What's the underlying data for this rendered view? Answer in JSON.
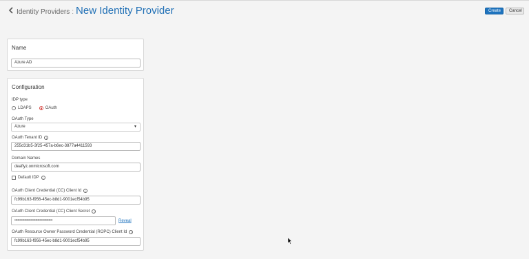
{
  "header": {
    "back_icon": "chevron-left-icon",
    "breadcrumb": "Identity Providers",
    "separator": ":",
    "title": "New Identity Provider"
  },
  "toolbar": {
    "create_label": "Create",
    "cancel_label": "Cancel"
  },
  "name_panel": {
    "title": "Name",
    "name_value": "Azure AD"
  },
  "config_panel": {
    "title": "Configuration",
    "idp_type_label": "IDP type",
    "idp_options": [
      {
        "label": "LDAPS",
        "checked": false
      },
      {
        "label": "OAuth",
        "checked": true
      }
    ],
    "oauth_type_label": "OAuth Type",
    "oauth_type_value": "Azure",
    "tenant_id_label": "OAuth Tenant ID",
    "tenant_id_value": "255d31b5-3f25-457a-b6ec-3877a4411593",
    "domain_names_label": "Domain Names",
    "domain_names_value": "deaflyz.onmicrosoft.com",
    "default_idp_label": "Default IDP",
    "cc_client_id_label": "OAuth Client Credential (CC) Client Id",
    "cc_client_id_value": "fc99b163-f956-45ec-b8d1-9001ecf54b95",
    "cc_client_secret_label": "OAuth Client Credential (CC) Client Secret",
    "cc_client_secret_value": "••••••••••••••••••••••••••••••••••••••",
    "reveal_label": "Reveal",
    "ropc_client_id_label": "OAuth Resource Owner Password Credential (ROPC) Client Id",
    "ropc_client_id_value": "fc99b163-f956-45ec-b8d1-9001ecf54b95"
  },
  "colors": {
    "accent": "#1f6fb5",
    "radio_checked": "#d9534f"
  }
}
